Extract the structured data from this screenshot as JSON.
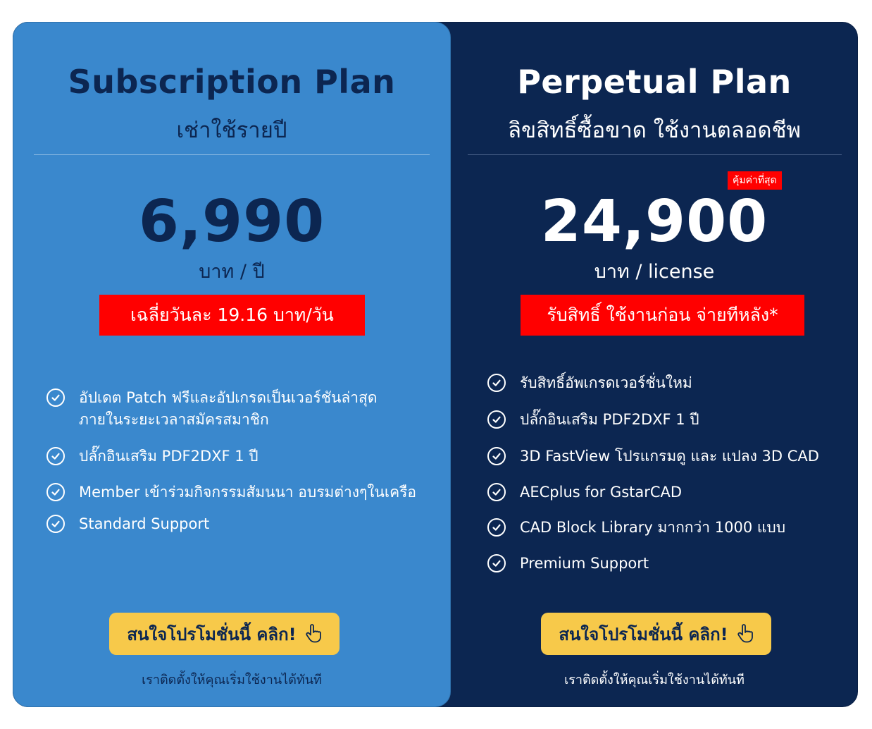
{
  "subscription": {
    "title": "Subscription Plan",
    "subtitle": "เช่าใช้รายปี",
    "price": "6,990",
    "unit": "บาท / ปี",
    "promo": "เฉลี่ยวันละ 19.16 บาท/วัน",
    "features": [
      [
        "อัปเดต Patch  ฟรีและอัปเกรดเป็นเวอร์ชันล่าสุด",
        "ภายในระยะเวลาสมัครสมาชิก"
      ],
      [
        "ปลั๊กอินเสริม PDF2DXF 1 ปี"
      ],
      [
        "Member เข้าร่วมกิจกรรมสัมนนา อบรมต่างๆในเครือ"
      ],
      [
        "Standard Support"
      ]
    ],
    "cta_label": "สนใจโปรโมชั่นนี้ คลิก!",
    "note": "เราติดตั้งให้คุณเริ่มใช้งานได้ทันที",
    "colors": {
      "background": "#3a88cd",
      "text": "#0c2651"
    }
  },
  "perpetual": {
    "title": "Perpetual Plan",
    "subtitle": "ลิขสิทธิ์ซื้อขาด ใช้งานตลอดชีพ",
    "badge": "คุ้มค่าที่สุด",
    "price": "24,900",
    "unit": "บาท / license",
    "promo": "รับสิทธิ์ ใช้งานก่อน จ่ายทีหลัง*",
    "features": [
      "รับสิทธิ์อัพเกรดเวอร์ชั่นใหม่",
      "ปลั๊กอินเสริม PDF2DXF 1 ปี",
      "3D FastView โปรแกรมดู และ แปลง 3D CAD",
      "AECplus for GstarCAD",
      "CAD Block Library มากกว่า 1000 แบบ",
      "Premium Support"
    ],
    "cta_label": "สนใจโปรโมชั่นนี้ คลิก!",
    "note": "เราติดตั้งให้คุณเริ่มใช้งานได้ทันที",
    "colors": {
      "background": "#0c2651",
      "text": "#ffffff"
    }
  },
  "icons": {
    "feature": "check-circle-icon",
    "cta": "hand-pointer-icon"
  },
  "colors": {
    "cta": "#f7c94a",
    "promo": "#ff0000"
  }
}
